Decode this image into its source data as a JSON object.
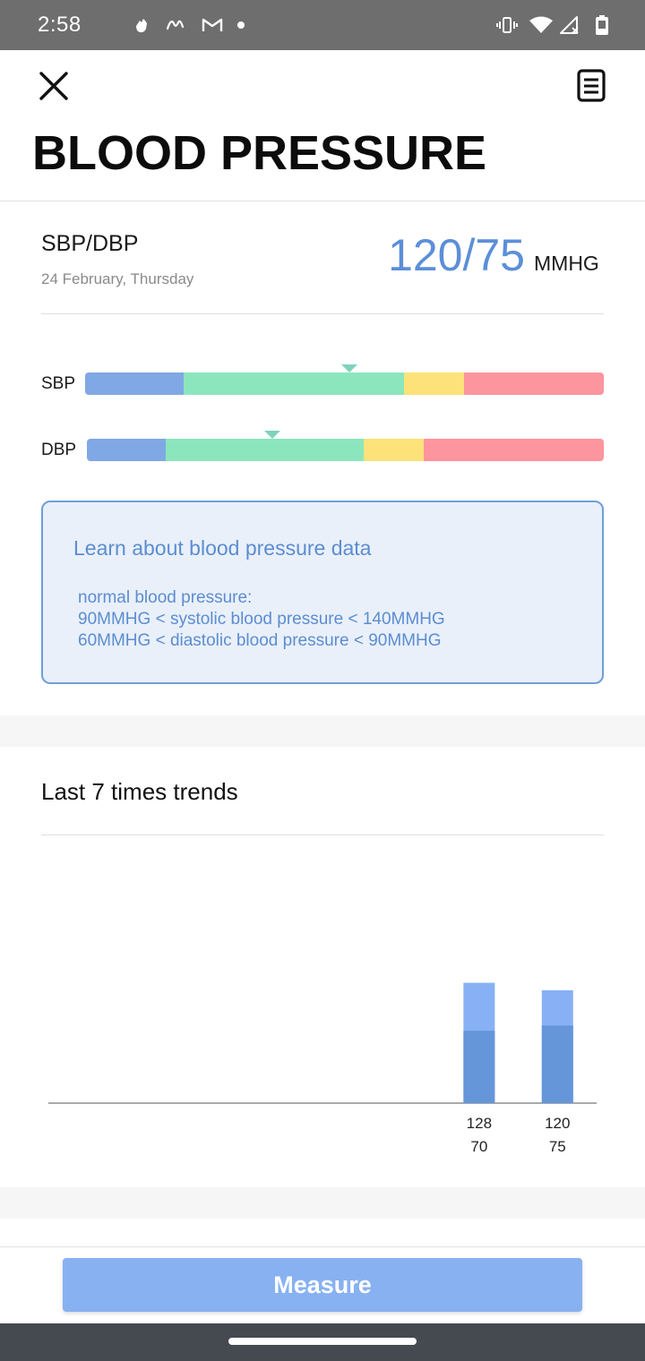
{
  "status_bar": {
    "time": "2:58",
    "icons": [
      "hand-icon",
      "scribble-icon",
      "gmail-icon",
      "dot-icon",
      "vibrate-icon",
      "wifi-icon",
      "signal-icon",
      "battery-icon"
    ]
  },
  "header": {
    "title": "BLOOD PRESSURE",
    "close_icon": "close-icon",
    "log_icon": "document-icon"
  },
  "reading": {
    "label": "SBP/DBP",
    "date": "24 February, Thursday",
    "value": "120/75",
    "unit": "MMHG"
  },
  "range_bars": {
    "colors": {
      "low": "#80a8e4",
      "normal": "#8ce6bd",
      "elevated": "#fde27a",
      "high": "#fc959d",
      "marker": "#7fd3bd"
    },
    "sbp": {
      "label": "SBP",
      "segments": [
        0.19,
        0.425,
        0.115,
        0.27
      ],
      "marker_fraction": 0.51
    },
    "dbp": {
      "label": "DBP",
      "segments": [
        0.152,
        0.384,
        0.116,
        0.348
      ],
      "marker_fraction": 0.358
    }
  },
  "info": {
    "title": "Learn about blood pressure data",
    "lines": [
      "normal blood pressure:",
      "90MMHG < systolic blood pressure < 140MMHG",
      "60MMHG < diastolic blood pressure < 90MMHG"
    ]
  },
  "trends": {
    "title": "Last 7 times trends"
  },
  "chart_data": {
    "type": "bar",
    "title": "Last 7 times trends",
    "categories": [
      "",
      "",
      "",
      "",
      "",
      "128\n70",
      "120\n75"
    ],
    "series": [
      {
        "values": [
          null,
          null,
          null,
          null,
          null,
          70,
          75
        ]
      },
      {
        "values": [
          null,
          null,
          null,
          null,
          null,
          128,
          120
        ]
      }
    ],
    "colors": {
      "dbp": "#6596da",
      "sbp": "#87b1f4"
    },
    "ylim": [
      0,
      200
    ],
    "grid": false
  },
  "footer": {
    "measure_label": "Measure"
  }
}
